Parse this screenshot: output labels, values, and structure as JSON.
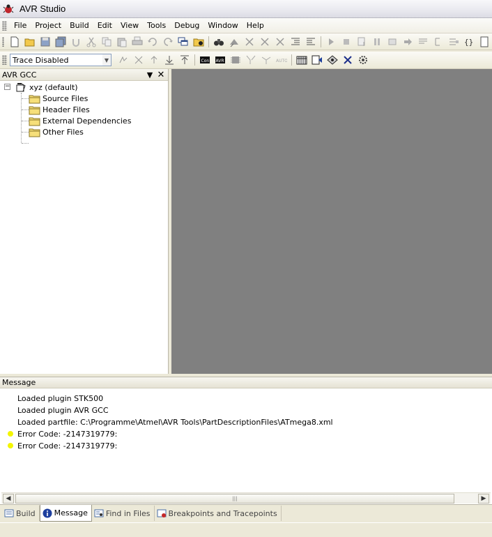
{
  "window": {
    "title": "AVR Studio"
  },
  "menu": [
    "File",
    "Project",
    "Build",
    "Edit",
    "View",
    "Tools",
    "Debug",
    "Window",
    "Help"
  ],
  "toolbar2": {
    "trace_combo_value": "Trace Disabled"
  },
  "left_pane": {
    "title": "AVR GCC",
    "project": "xyz (default)",
    "folders": [
      "Source Files",
      "Header Files",
      "External Dependencies",
      "Other Files"
    ]
  },
  "message_pane": {
    "title": "Message",
    "lines": [
      {
        "text": "Loaded plugin STK500",
        "marker": false
      },
      {
        "text": "Loaded plugin AVR GCC",
        "marker": false
      },
      {
        "text": "Loaded partfile: C:\\Programme\\Atmel\\AVR Tools\\PartDescriptionFiles\\ATmega8.xml",
        "marker": false
      },
      {
        "text": "Error Code: -2147319779:",
        "marker": true
      },
      {
        "text": "Error Code: -2147319779:",
        "marker": true
      }
    ]
  },
  "tabs": [
    {
      "label": "Build",
      "icon": "build-icon",
      "active": false
    },
    {
      "label": "Message",
      "icon": "info-icon",
      "active": true
    },
    {
      "label": "Find in Files",
      "icon": "find-in-files-icon",
      "active": false
    },
    {
      "label": "Breakpoints and Tracepoints",
      "icon": "breakpoints-icon",
      "active": false
    }
  ],
  "colors": {
    "document_area": "#808080",
    "message_marker": "#f3f500",
    "chrome": "#ece9d8"
  }
}
